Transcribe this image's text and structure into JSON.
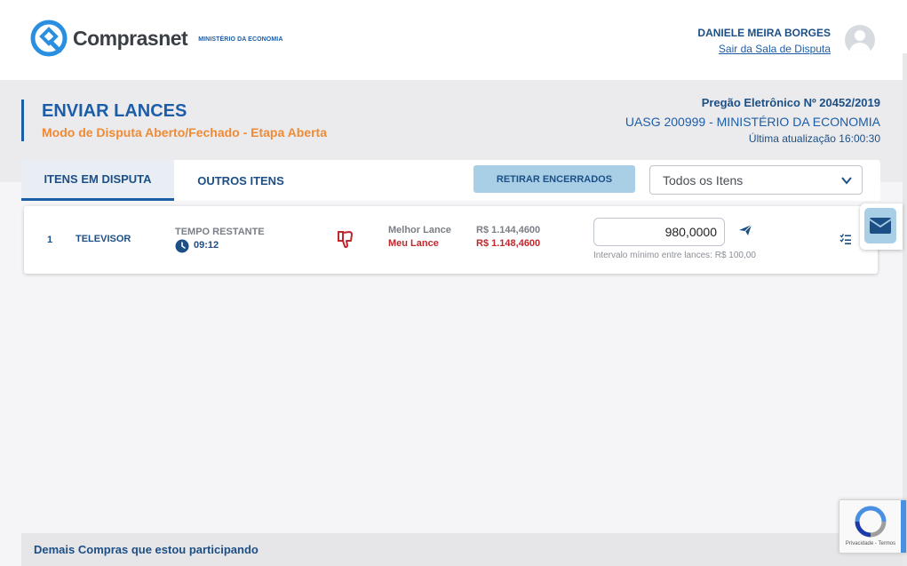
{
  "header": {
    "logo_text": "Comprasnet",
    "logo_sub": "MINISTÉRIO DA ECONOMIA",
    "user_name": "DANIELE MEIRA BORGES",
    "logout_label": "Sair da Sala de Disputa"
  },
  "page": {
    "title": "ENVIAR LANCES",
    "subtitle": "Modo de Disputa Aberto/Fechado - Etapa Aberta",
    "pregao": "Pregão Eletrônico Nº 20452/2019",
    "uasg": "UASG 200999 - MINISTÉRIO DA ECONOMIA",
    "last_update": "Última atualização 16:00:30"
  },
  "tabs": [
    {
      "label": "ITENS EM DISPUTA",
      "active": true
    },
    {
      "label": "OUTROS ITENS",
      "active": false
    }
  ],
  "toolbar": {
    "retirar_label": "RETIRAR ENCERRADOS",
    "filter_selected": "Todos os Itens"
  },
  "item": {
    "number": "1",
    "name": "TELEVISOR",
    "time_label": "TEMPO RESTANTE",
    "time_value": "09:12",
    "best_label": "Melhor Lance",
    "mine_label": "Meu Lance",
    "best_value": "R$ 1.144,4600",
    "mine_value": "R$ 1.148,4600",
    "bid_value": "980,0000",
    "hint": "Intervalo mínimo entre lances: R$ 100,00"
  },
  "bottom": {
    "label": "Demais Compras que estou participando"
  },
  "recaptcha": {
    "text": "Privacidade - Termos"
  },
  "colors": {
    "primary": "#1c5da8",
    "accent": "#ef8a35",
    "danger": "#c0272d",
    "light_blue": "#a8cfe6"
  }
}
